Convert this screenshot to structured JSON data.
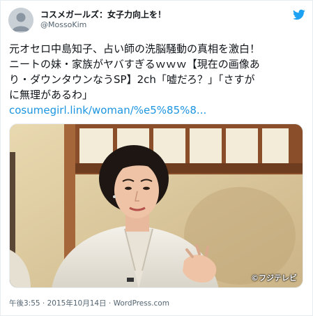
{
  "author": {
    "name": "コスメガールズ：女子力向上を！",
    "handle": "@MossoKim"
  },
  "tweet": {
    "lines": [
      "元オセロ中島知子、占い師の洗脳騒動の真相を激白！",
      "ニートの妹・家族がヤバすぎるｗｗｗ【現在の画像あ",
      "り・ダウンタウンなうSP】2ch「嘘だろ？」「さすが",
      "に無理があるわ」"
    ],
    "link": "cosumegirl.link/woman/%e5%85%8..."
  },
  "media": {
    "credit": "©フジテレビ"
  },
  "meta": {
    "time": "午後3:55",
    "sep1": " · ",
    "date": "2015年10月14日",
    "sep2": " · ",
    "source": "WordPress.com"
  },
  "icons": {
    "brand": "twitter-bird-icon",
    "brand_color": "#1da1f2",
    "link_color": "#1b95e0"
  }
}
